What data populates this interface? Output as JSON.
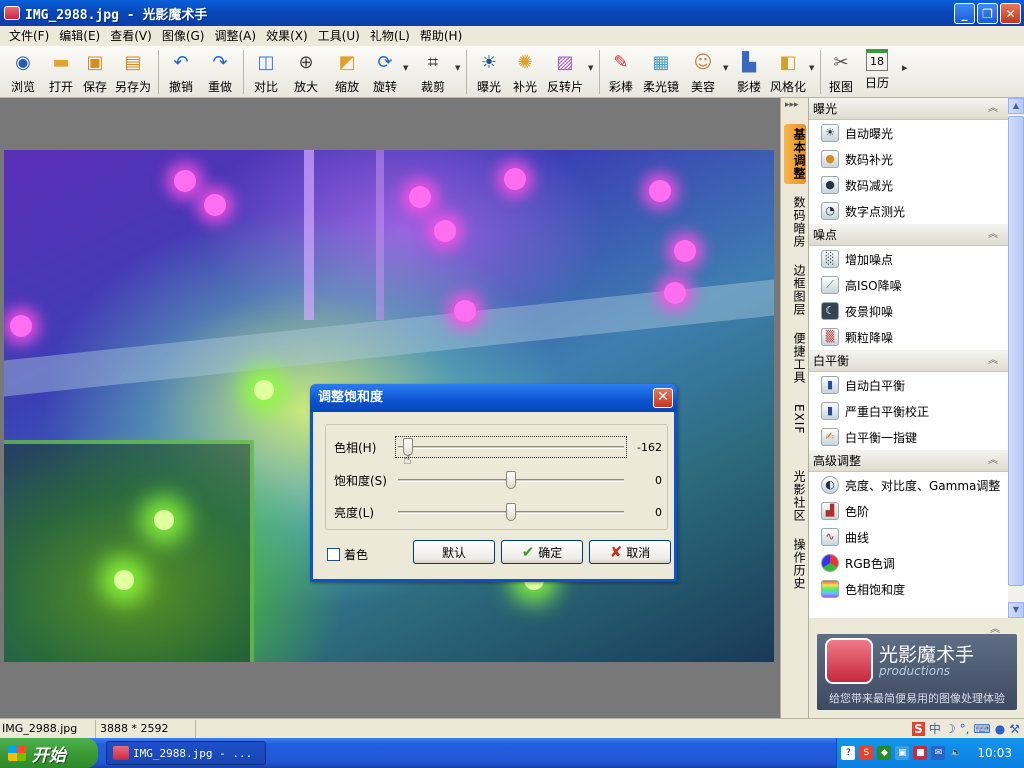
{
  "window": {
    "title": "IMG_2988.jpg - 光影魔术手",
    "buttons": {
      "min": "_",
      "max": "❐",
      "close": "✕"
    }
  },
  "menu": [
    "文件(F)",
    "编辑(E)",
    "查看(V)",
    "图像(G)",
    "调整(A)",
    "效果(X)",
    "工具(U)",
    "礼物(L)",
    "帮助(H)"
  ],
  "toolbar": {
    "items": [
      {
        "label": "浏览",
        "icon": "eye-icon"
      },
      {
        "label": "打开",
        "icon": "folder-icon"
      },
      {
        "label": "保存",
        "icon": "save-icon"
      },
      {
        "label": "另存为",
        "icon": "save-as-icon"
      },
      {
        "label": "撤销",
        "icon": "undo-icon"
      },
      {
        "label": "重做",
        "icon": "redo-icon"
      },
      {
        "label": "对比",
        "icon": "compare-icon"
      },
      {
        "label": "放大",
        "icon": "zoom-in-icon"
      },
      {
        "label": "缩放",
        "icon": "resize-icon"
      },
      {
        "label": "旋转",
        "icon": "rotate-icon"
      },
      {
        "label": "裁剪",
        "icon": "crop-icon"
      },
      {
        "label": "曝光",
        "icon": "exposure-icon"
      },
      {
        "label": "补光",
        "icon": "fill-light-icon"
      },
      {
        "label": "反转片",
        "icon": "slide-film-icon"
      },
      {
        "label": "彩棒",
        "icon": "color-wand-icon"
      },
      {
        "label": "柔光镜",
        "icon": "soft-light-icon"
      },
      {
        "label": "美容",
        "icon": "beauty-icon"
      },
      {
        "label": "影楼",
        "icon": "studio-icon"
      },
      {
        "label": "风格化",
        "icon": "stylize-icon"
      },
      {
        "label": "抠图",
        "icon": "cutout-icon"
      },
      {
        "label": "日历",
        "icon": "calendar-icon",
        "badge": "18"
      }
    ]
  },
  "dialog": {
    "title": "调整饱和度",
    "sliders": [
      {
        "label": "色相(H)",
        "value": "-162",
        "position": 0.03
      },
      {
        "label": "饱和度(S)",
        "value": "0",
        "position": 0.5
      },
      {
        "label": "亮度(L)",
        "value": "0",
        "position": 0.5
      }
    ],
    "colorize_label": "着色",
    "buttons": {
      "default": "默认",
      "ok": "确定",
      "cancel": "取消"
    }
  },
  "side_tabs": [
    "基本调整",
    "数码暗房",
    "边框图层",
    "便捷工具",
    "EXIF",
    "光影社区",
    "操作历史"
  ],
  "panel": {
    "sections": [
      {
        "title": "曝光",
        "items": [
          {
            "label": "自动曝光",
            "icon": "auto-exposure-icon"
          },
          {
            "label": "数码补光",
            "icon": "digital-fill-light-icon"
          },
          {
            "label": "数码减光",
            "icon": "digital-reduce-light-icon"
          },
          {
            "label": "数字点测光",
            "icon": "spot-metering-icon"
          }
        ]
      },
      {
        "title": "噪点",
        "items": [
          {
            "label": "增加噪点",
            "icon": "add-noise-icon"
          },
          {
            "label": "高ISO降噪",
            "icon": "high-iso-denoise-icon"
          },
          {
            "label": "夜景抑噪",
            "icon": "night-denoise-icon"
          },
          {
            "label": "颗粒降噪",
            "icon": "grain-denoise-icon"
          }
        ]
      },
      {
        "title": "白平衡",
        "items": [
          {
            "label": "自动白平衡",
            "icon": "auto-white-balance-icon"
          },
          {
            "label": "严重白平衡校正",
            "icon": "severe-white-balance-icon"
          },
          {
            "label": "白平衡一指键",
            "icon": "one-touch-white-balance-icon"
          }
        ]
      },
      {
        "title": "高级调整",
        "items": [
          {
            "label": "亮度、对比度、Gamma调整",
            "icon": "brightness-contrast-icon"
          },
          {
            "label": "色阶",
            "icon": "levels-icon"
          },
          {
            "label": "曲线",
            "icon": "curves-icon"
          },
          {
            "label": "RGB色调",
            "icon": "rgb-tone-icon"
          },
          {
            "label": "色相饱和度",
            "icon": "hue-saturation-icon"
          }
        ]
      }
    ]
  },
  "promo": {
    "name": "光影魔术手",
    "sub": "productions",
    "tagline": "给您带来最简便易用的图像处理体验"
  },
  "status": {
    "filename": "IMG_2988.jpg",
    "dimensions": "3888 * 2592"
  },
  "taskbar": {
    "start": "开始",
    "task": "IMG_2988.jpg - ...",
    "clock": "10:03"
  },
  "colors": {
    "accent": "#0a53d0",
    "start_green": "#3c9c37",
    "active_tab": "#e8902a"
  }
}
